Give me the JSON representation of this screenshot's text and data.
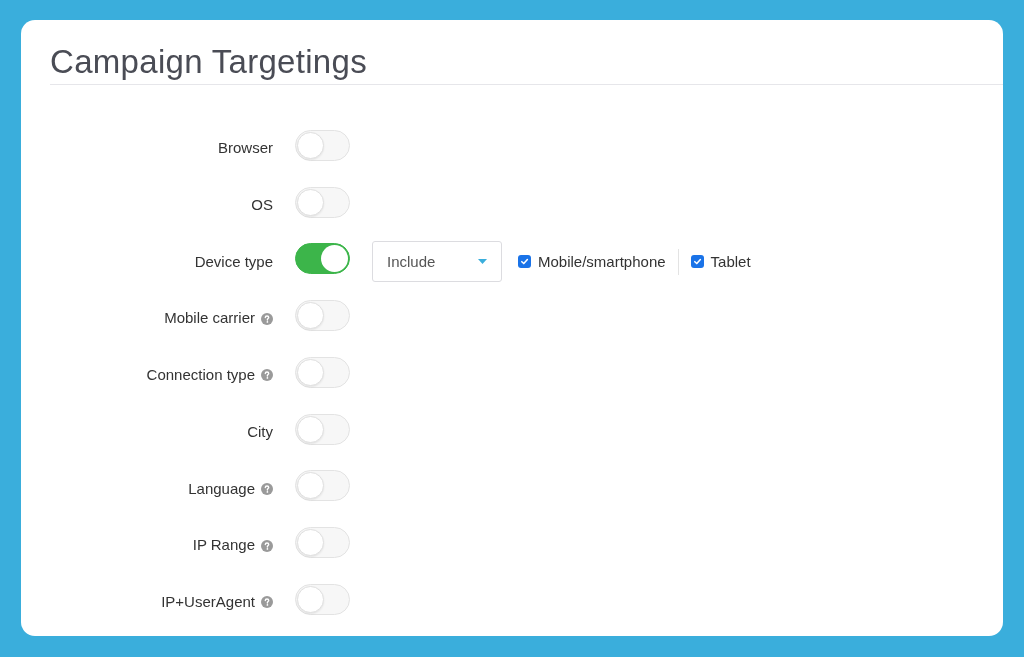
{
  "title": "Campaign Targetings",
  "targetings": [
    {
      "label": "Browser",
      "help": false,
      "on": false
    },
    {
      "label": "OS",
      "help": false,
      "on": false
    },
    {
      "label": "Device type",
      "help": false,
      "on": true,
      "mode": {
        "value": "Include"
      },
      "options": [
        {
          "label": "Mobile/smartphone",
          "checked": true
        },
        {
          "label": "Tablet",
          "checked": true
        }
      ]
    },
    {
      "label": "Mobile carrier",
      "help": true,
      "on": false
    },
    {
      "label": "Connection type",
      "help": true,
      "on": false
    },
    {
      "label": "City",
      "help": false,
      "on": false
    },
    {
      "label": "Language",
      "help": true,
      "on": false
    },
    {
      "label": "IP Range",
      "help": true,
      "on": false
    },
    {
      "label": "IP+UserAgent",
      "help": true,
      "on": false
    }
  ]
}
